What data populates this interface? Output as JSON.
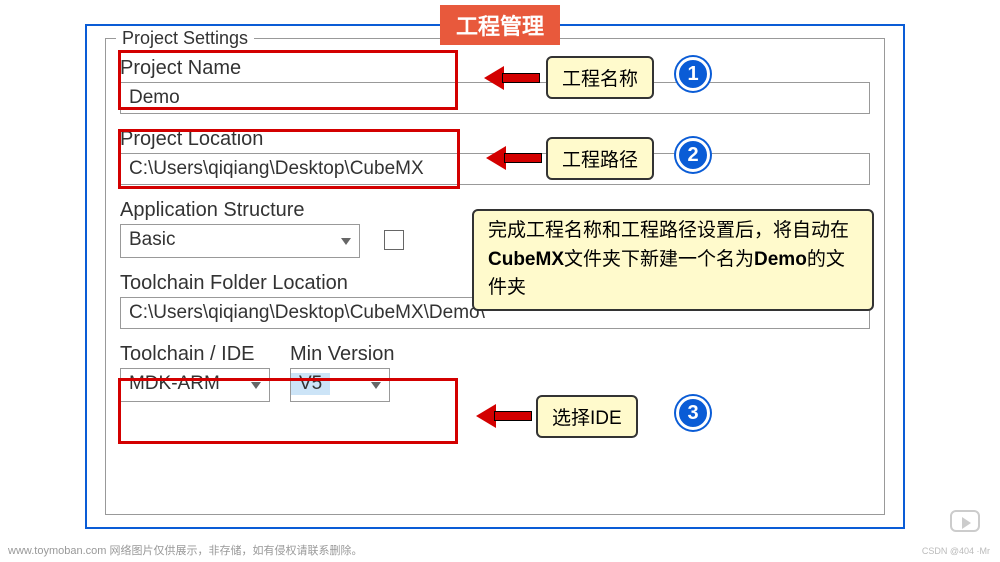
{
  "title_banner": "工程管理",
  "fieldset": {
    "legend": "Project Settings",
    "project_name": {
      "label": "Project Name",
      "value": "Demo"
    },
    "project_location": {
      "label": "Project Location",
      "value": "C:\\Users\\qiqiang\\Desktop\\CubeMX"
    },
    "app_structure": {
      "label": "Application Structure",
      "value": "Basic"
    },
    "toolchain_folder": {
      "label": "Toolchain Folder Location",
      "value": "C:\\Users\\qiqiang\\Desktop\\CubeMX\\Demo\\"
    },
    "toolchain_ide": {
      "label": "Toolchain / IDE",
      "value": "MDK-ARM"
    },
    "min_version": {
      "label": "Min Version",
      "value": "V5"
    }
  },
  "callouts": {
    "c1": "工程名称",
    "c2": "工程路径",
    "c3_part1": "完成工程名称和工程路径设置后，将自动在",
    "c3_bold1": "CubeMX",
    "c3_part2": "文件夹下新建一个名为",
    "c3_bold2": "Demo",
    "c3_part3": "的文件夹",
    "c4": "选择IDE"
  },
  "badges": {
    "b1": "1",
    "b2": "2",
    "b3": "3"
  },
  "footer": "www.toymoban.com 网络图片仅供展示，非存储，如有侵权请联系删除。",
  "watermark_right": "CSDN @404 ·Mr"
}
